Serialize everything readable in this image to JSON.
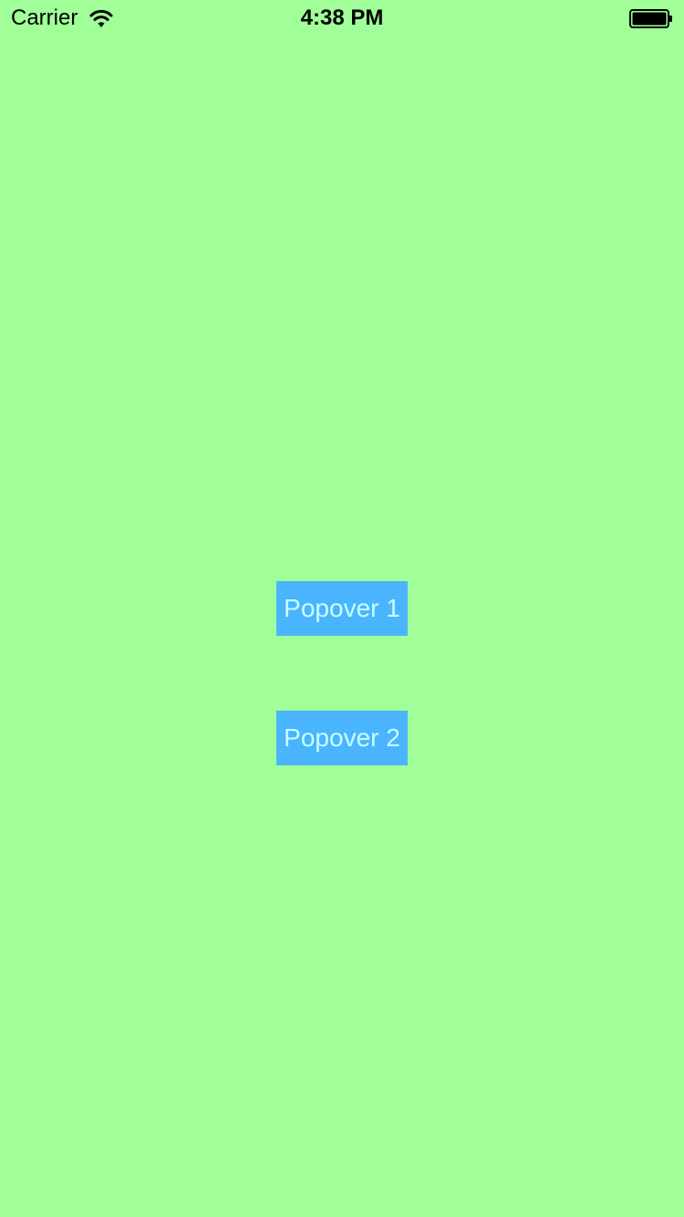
{
  "status_bar": {
    "carrier": "Carrier",
    "time": "4:38 PM",
    "wifi_icon": "wifi-icon",
    "battery_icon": "battery-icon"
  },
  "buttons": [
    {
      "label": "Popover 1"
    },
    {
      "label": "Popover 2"
    }
  ],
  "colors": {
    "background": "#a0ff99",
    "button_background": "#4ab4ff",
    "button_text": "#c8ffff"
  }
}
